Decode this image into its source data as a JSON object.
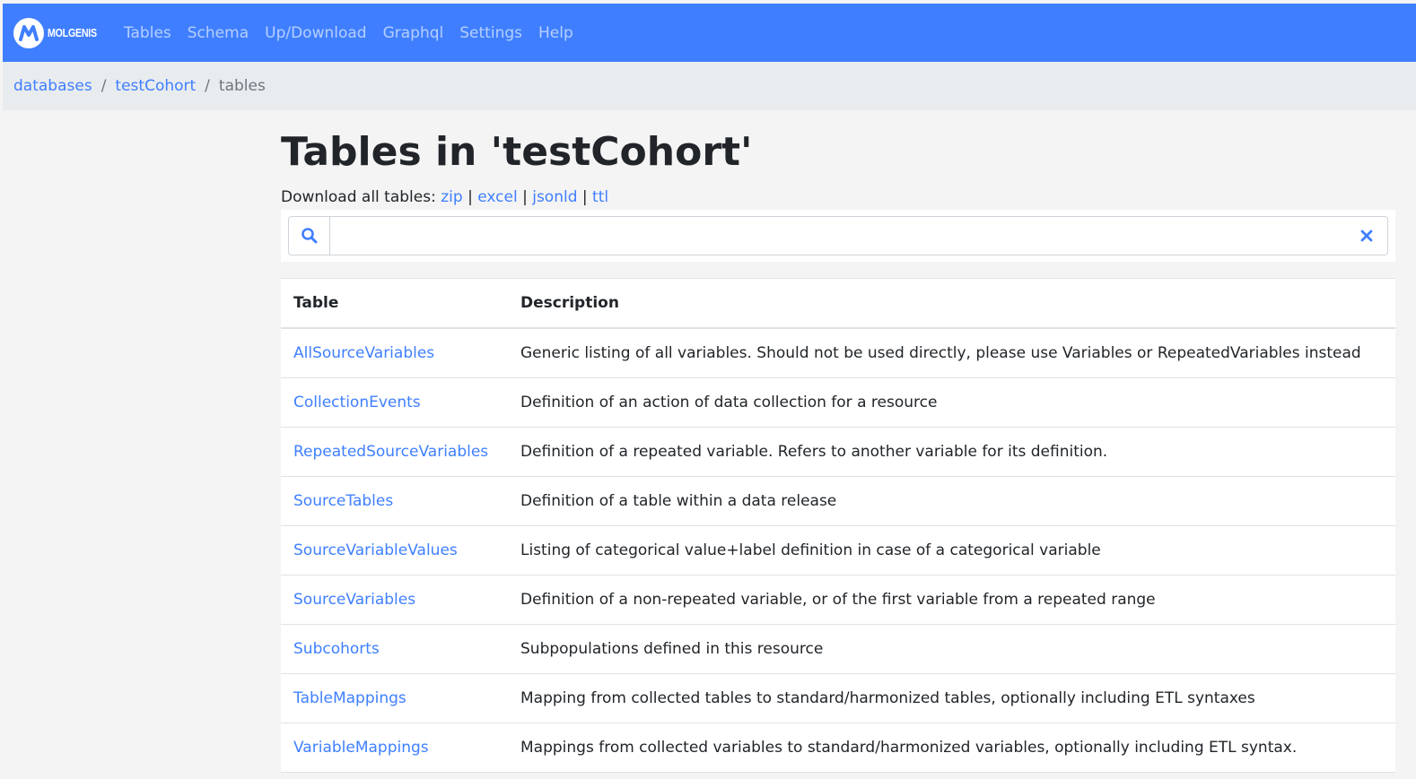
{
  "navbar": {
    "brand": "MOLGENIS",
    "links": [
      "Tables",
      "Schema",
      "Up/Download",
      "Graphql",
      "Settings",
      "Help"
    ]
  },
  "breadcrumb": {
    "items": [
      "databases",
      "testCohort"
    ],
    "active": "tables",
    "separator": "/"
  },
  "page": {
    "title": "Tables in 'testCohort'",
    "download_label": "Download all tables:",
    "download_links": [
      "zip",
      "excel",
      "jsonld",
      "ttl"
    ],
    "download_separator": "|"
  },
  "search": {
    "value": "",
    "placeholder": ""
  },
  "table": {
    "headers": [
      "Table",
      "Description"
    ],
    "rows": [
      {
        "name": "AllSourceVariables",
        "description": "Generic listing of all variables. Should not be used directly, please use Variables or RepeatedVariables instead"
      },
      {
        "name": "CollectionEvents",
        "description": "Definition of an action of data collection for a resource"
      },
      {
        "name": "RepeatedSourceVariables",
        "description": "Definition of a repeated variable. Refers to another variable for its definition."
      },
      {
        "name": "SourceTables",
        "description": "Definition of a table within a data release"
      },
      {
        "name": "SourceVariableValues",
        "description": "Listing of categorical value+label definition in case of a categorical variable"
      },
      {
        "name": "SourceVariables",
        "description": "Definition of a non-repeated variable, or of the first variable from a repeated range"
      },
      {
        "name": "Subcohorts",
        "description": "Subpopulations defined in this resource"
      },
      {
        "name": "TableMappings",
        "description": "Mapping from collected tables to standard/harmonized tables, optionally including ETL syntaxes"
      },
      {
        "name": "VariableMappings",
        "description": "Mappings from collected variables to standard/harmonized variables, optionally including ETL syntax."
      }
    ]
  },
  "colors": {
    "navbar": "#3f7fff",
    "link": "#3f7fff",
    "breadcrumb_bg": "#e9ecef",
    "page_bg": "#f4f4f4"
  }
}
